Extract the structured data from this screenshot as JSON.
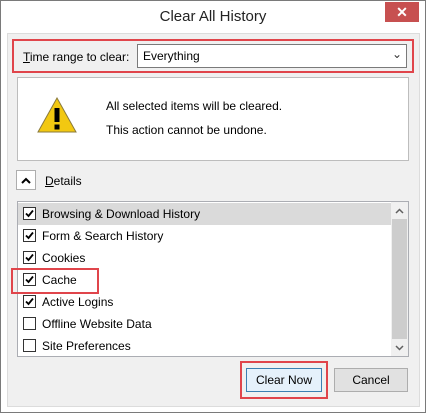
{
  "window": {
    "title": "Clear All History",
    "close_glyph": "✕"
  },
  "time_range": {
    "label_accel": "T",
    "label_rest": "ime range to clear:",
    "selected": "Everything",
    "chevron": "⌄"
  },
  "warning": {
    "icon": "warning-icon",
    "line1": "All selected items will be cleared.",
    "line2": "This action cannot be undone."
  },
  "details": {
    "accel": "D",
    "rest": "etails",
    "expanded": true
  },
  "items": [
    {
      "label": "Browsing & Download History",
      "checked": true,
      "selected": true
    },
    {
      "label": "Form & Search History",
      "checked": true,
      "selected": false
    },
    {
      "label": "Cookies",
      "checked": true,
      "selected": false
    },
    {
      "label": "Cache",
      "checked": true,
      "selected": false
    },
    {
      "label": "Active Logins",
      "checked": true,
      "selected": false
    },
    {
      "label": "Offline Website Data",
      "checked": false,
      "selected": false
    },
    {
      "label": "Site Preferences",
      "checked": false,
      "selected": false
    }
  ],
  "buttons": {
    "clear_now": "Clear Now",
    "cancel": "Cancel"
  },
  "colors": {
    "highlight": "#e0454b",
    "close_button": "#c75050",
    "warning_yellow": "#f2c811"
  }
}
